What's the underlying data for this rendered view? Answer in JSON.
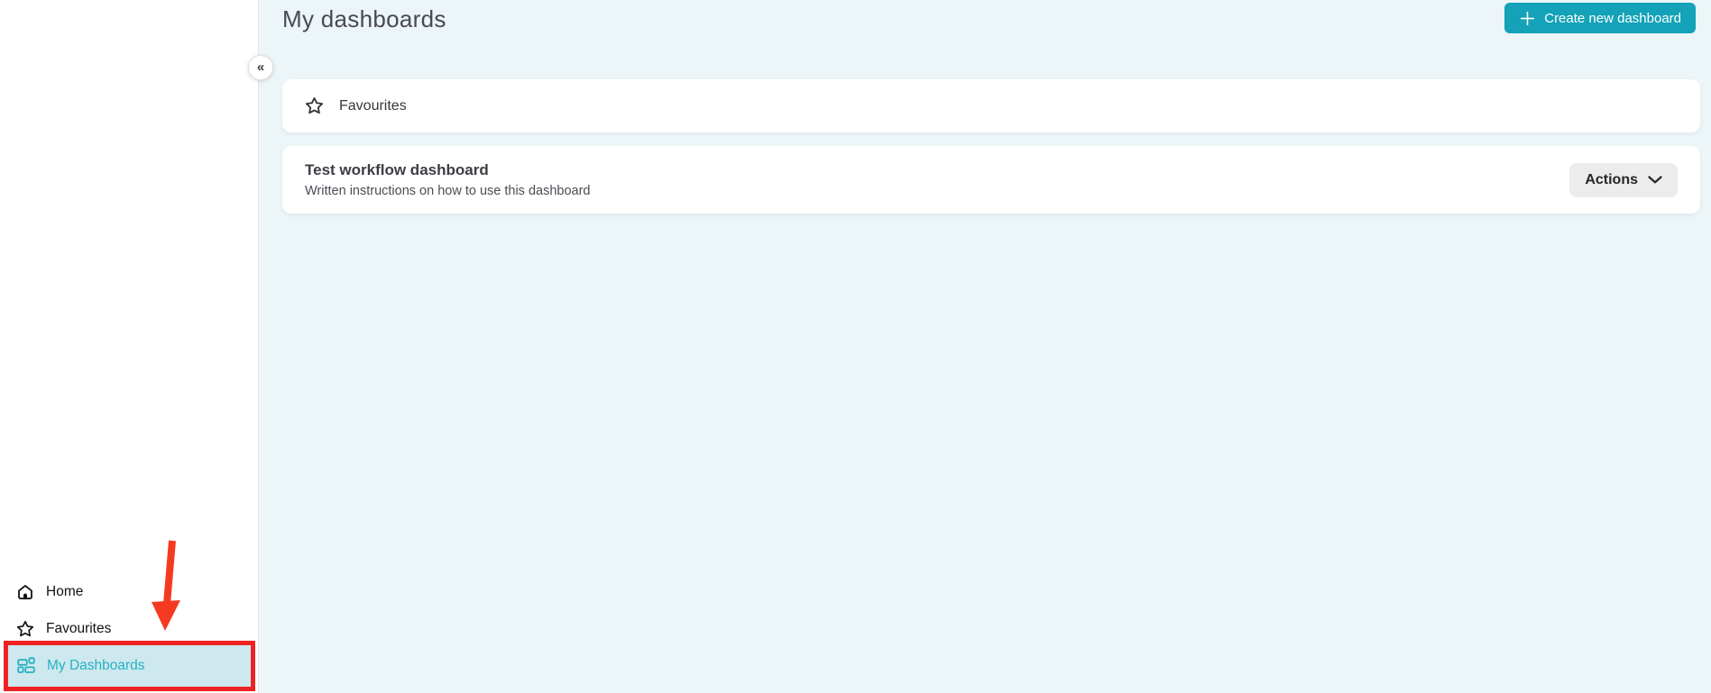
{
  "sidebar": {
    "collapse_icon": "«",
    "items": [
      {
        "label": "Home",
        "icon": "home-icon",
        "active": false
      },
      {
        "label": "Favourites",
        "icon": "star-icon",
        "active": false
      },
      {
        "label": "My Dashboards",
        "icon": "dashboard-icon",
        "active": true
      }
    ],
    "annotation": {
      "arrow_color": "#f43b22",
      "box_color": "#ee2222"
    }
  },
  "header": {
    "title": "My dashboards",
    "create_button": {
      "label": "Create new dashboard",
      "icon": "plus-icon"
    }
  },
  "favourites_section": {
    "label": "Favourites",
    "icon": "star-icon"
  },
  "dashboards": [
    {
      "title": "Test workflow dashboard",
      "description": "Written instructions on how to use this dashboard",
      "actions_label": "Actions"
    }
  ],
  "colors": {
    "accent_teal": "#13a2b8",
    "active_item_text": "#28b1c3",
    "active_item_bg": "#cde8ee",
    "main_bg": "#ecf5f7",
    "annotation_red": "#ee2222"
  }
}
